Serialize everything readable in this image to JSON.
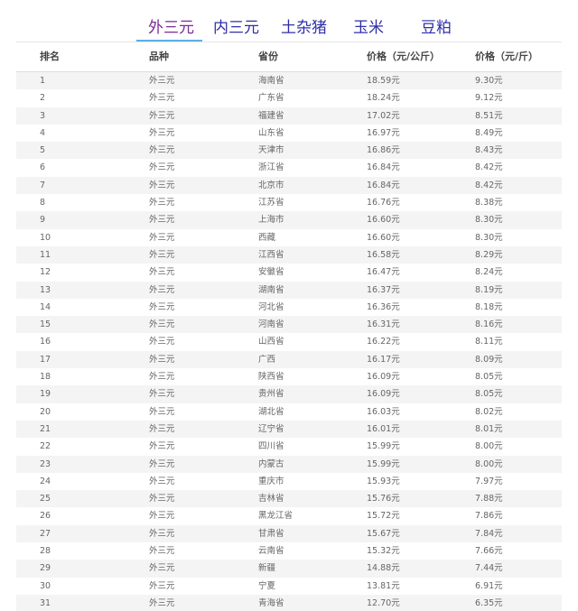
{
  "tabs": [
    {
      "label": "外三元",
      "active": true
    },
    {
      "label": "内三元",
      "active": false
    },
    {
      "label": "土杂猪",
      "active": false
    },
    {
      "label": "玉米",
      "active": false
    },
    {
      "label": "豆粕",
      "active": false
    }
  ],
  "table": {
    "headers": [
      "排名",
      "品种",
      "省份",
      "价格（元/公斤）",
      "价格（元/斤）"
    ],
    "rows": [
      [
        "1",
        "外三元",
        "海南省",
        "18.59元",
        "9.30元"
      ],
      [
        "2",
        "外三元",
        "广东省",
        "18.24元",
        "9.12元"
      ],
      [
        "3",
        "外三元",
        "福建省",
        "17.02元",
        "8.51元"
      ],
      [
        "4",
        "外三元",
        "山东省",
        "16.97元",
        "8.49元"
      ],
      [
        "5",
        "外三元",
        "天津市",
        "16.86元",
        "8.43元"
      ],
      [
        "6",
        "外三元",
        "浙江省",
        "16.84元",
        "8.42元"
      ],
      [
        "7",
        "外三元",
        "北京市",
        "16.84元",
        "8.42元"
      ],
      [
        "8",
        "外三元",
        "江苏省",
        "16.76元",
        "8.38元"
      ],
      [
        "9",
        "外三元",
        "上海市",
        "16.60元",
        "8.30元"
      ],
      [
        "10",
        "外三元",
        "西藏",
        "16.60元",
        "8.30元"
      ],
      [
        "11",
        "外三元",
        "江西省",
        "16.58元",
        "8.29元"
      ],
      [
        "12",
        "外三元",
        "安徽省",
        "16.47元",
        "8.24元"
      ],
      [
        "13",
        "外三元",
        "湖南省",
        "16.37元",
        "8.19元"
      ],
      [
        "14",
        "外三元",
        "河北省",
        "16.36元",
        "8.18元"
      ],
      [
        "15",
        "外三元",
        "河南省",
        "16.31元",
        "8.16元"
      ],
      [
        "16",
        "外三元",
        "山西省",
        "16.22元",
        "8.11元"
      ],
      [
        "17",
        "外三元",
        "广西",
        "16.17元",
        "8.09元"
      ],
      [
        "18",
        "外三元",
        "陕西省",
        "16.09元",
        "8.05元"
      ],
      [
        "19",
        "外三元",
        "贵州省",
        "16.09元",
        "8.05元"
      ],
      [
        "20",
        "外三元",
        "湖北省",
        "16.03元",
        "8.02元"
      ],
      [
        "21",
        "外三元",
        "辽宁省",
        "16.01元",
        "8.01元"
      ],
      [
        "22",
        "外三元",
        "四川省",
        "15.99元",
        "8.00元"
      ],
      [
        "23",
        "外三元",
        "内蒙古",
        "15.99元",
        "8.00元"
      ],
      [
        "24",
        "外三元",
        "重庆市",
        "15.93元",
        "7.97元"
      ],
      [
        "25",
        "外三元",
        "吉林省",
        "15.76元",
        "7.88元"
      ],
      [
        "26",
        "外三元",
        "黑龙江省",
        "15.72元",
        "7.86元"
      ],
      [
        "27",
        "外三元",
        "甘肃省",
        "15.67元",
        "7.84元"
      ],
      [
        "28",
        "外三元",
        "云南省",
        "15.32元",
        "7.66元"
      ],
      [
        "29",
        "外三元",
        "新疆",
        "14.88元",
        "7.44元"
      ],
      [
        "30",
        "外三元",
        "宁夏",
        "13.81元",
        "6.91元"
      ],
      [
        "31",
        "外三元",
        "青海省",
        "12.70元",
        "6.35元"
      ]
    ]
  }
}
